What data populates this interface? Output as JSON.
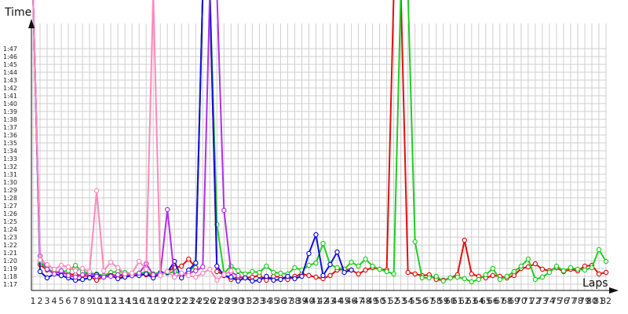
{
  "chart_data": {
    "type": "line",
    "xlabel": "Laps",
    "ylabel": "Time",
    "ylim": [
      "1:17",
      "1:48"
    ],
    "y_ticks": [
      "1:17",
      "1:18",
      "1:19",
      "1:20",
      "1:21",
      "1:22",
      "1:23",
      "1:24",
      "1:25",
      "1:26",
      "1:27",
      "1:28",
      "1:29",
      "1:30",
      "1:31",
      "1:32",
      "1:33",
      "1:34",
      "1:35",
      "1:36",
      "1:37",
      "1:38",
      "1:39",
      "1:40",
      "1:41",
      "1:42",
      "1:43",
      "1:44",
      "1:45",
      "1:46",
      "1:47"
    ],
    "x_ticks": [
      1,
      2,
      3,
      4,
      5,
      6,
      7,
      8,
      9,
      10,
      11,
      12,
      13,
      14,
      15,
      16,
      17,
      18,
      19,
      20,
      21,
      22,
      23,
      24,
      25,
      26,
      27,
      28,
      29,
      30,
      31,
      32,
      33,
      34,
      35,
      36,
      37,
      38,
      39,
      40,
      41,
      42,
      43,
      44,
      45,
      46,
      47,
      48,
      49,
      50,
      51,
      52,
      53,
      54,
      55,
      56,
      57,
      58,
      59,
      60,
      61,
      62,
      63,
      64,
      65,
      66,
      67,
      68,
      69,
      70,
      71,
      72,
      73,
      74,
      75,
      76,
      77,
      78,
      79,
      80,
      81,
      82
    ],
    "grid": true,
    "series": [
      {
        "color": "#e01010",
        "marker_laps": [],
        "points": [
          [
            1,
            120
          ],
          [
            2,
            79.5
          ],
          [
            3,
            78.8
          ],
          [
            4,
            78.6
          ],
          [
            5,
            78.4
          ],
          [
            6,
            78.3
          ],
          [
            7,
            78.2
          ],
          [
            8,
            78.1
          ],
          [
            9,
            78
          ],
          [
            10,
            77.5
          ],
          [
            11,
            78
          ],
          [
            12,
            78.2
          ],
          [
            13,
            78.1
          ],
          [
            14,
            78
          ],
          [
            15,
            78.1
          ],
          [
            16,
            78.3
          ],
          [
            17,
            78.2
          ],
          [
            18,
            78.3
          ],
          [
            19,
            78.1
          ],
          [
            20,
            78.6
          ],
          [
            21,
            79.1
          ],
          [
            22,
            79.3
          ],
          [
            23,
            80.2
          ],
          [
            24,
            79.1
          ],
          [
            25,
            120
          ],
          [
            26,
            120
          ],
          [
            27,
            78.6
          ],
          [
            28,
            78.2
          ],
          [
            29,
            77.6
          ],
          [
            30,
            77.9
          ],
          [
            31,
            77.8
          ],
          [
            32,
            77.9
          ],
          [
            33,
            78.1
          ],
          [
            34,
            77.5
          ],
          [
            35,
            78
          ],
          [
            36,
            77.9
          ],
          [
            37,
            77.6
          ],
          [
            38,
            78
          ],
          [
            39,
            78.3
          ],
          [
            40,
            78.1
          ],
          [
            41,
            77.9
          ],
          [
            42,
            77.7
          ],
          [
            43,
            78.1
          ],
          [
            44,
            78.8
          ],
          [
            45,
            78.9
          ],
          [
            46,
            78.8
          ],
          [
            47,
            78.3
          ],
          [
            48,
            78.8
          ],
          [
            49,
            79.1
          ],
          [
            50,
            78.9
          ],
          [
            51,
            78.8
          ],
          [
            52,
            120
          ],
          [
            53,
            120
          ],
          [
            54,
            78.5
          ],
          [
            55,
            78.3
          ],
          [
            56,
            78.1
          ],
          [
            57,
            78.2
          ],
          [
            58,
            77.6
          ],
          [
            59,
            77.5
          ],
          [
            60,
            77.8
          ],
          [
            61,
            78.2
          ],
          [
            62,
            82.6
          ],
          [
            63,
            78.3
          ],
          [
            64,
            78
          ],
          [
            65,
            77.8
          ],
          [
            66,
            78.1
          ],
          [
            67,
            78
          ],
          [
            68,
            77.8
          ],
          [
            69,
            78.1
          ],
          [
            70,
            79
          ],
          [
            71,
            79.2
          ],
          [
            72,
            79.6
          ],
          [
            73,
            78.9
          ],
          [
            74,
            78.7
          ],
          [
            75,
            79.1
          ],
          [
            76,
            78.6
          ],
          [
            77,
            78.9
          ],
          [
            78,
            78.7
          ],
          [
            79,
            79.3
          ],
          [
            80,
            79.4
          ],
          [
            81,
            78.3
          ],
          [
            82,
            78.5
          ]
        ]
      },
      {
        "color": "#22cc22",
        "marker_laps": [],
        "points": [
          [
            1,
            120
          ],
          [
            2,
            79.8
          ],
          [
            3,
            79
          ],
          [
            4,
            78.5
          ],
          [
            5,
            78.6
          ],
          [
            6,
            78.7
          ],
          [
            7,
            79.4
          ],
          [
            8,
            78.6
          ],
          [
            9,
            78.4
          ],
          [
            10,
            78.3
          ],
          [
            11,
            78.1
          ],
          [
            12,
            78.5
          ],
          [
            13,
            78.6
          ],
          [
            14,
            78.5
          ],
          [
            15,
            78.3
          ],
          [
            16,
            78.4
          ],
          [
            17,
            78.5
          ],
          [
            18,
            78.3
          ],
          [
            19,
            78.5
          ],
          [
            20,
            78.4
          ],
          [
            21,
            78.6
          ],
          [
            22,
            78.3
          ],
          [
            23,
            78.4
          ],
          [
            24,
            79.6
          ],
          [
            25,
            120
          ],
          [
            26,
            120
          ],
          [
            27,
            84.6
          ],
          [
            28,
            78.4
          ],
          [
            29,
            79.3
          ],
          [
            30,
            78.7
          ],
          [
            31,
            78.3
          ],
          [
            32,
            78.6
          ],
          [
            33,
            78.5
          ],
          [
            34,
            79.3
          ],
          [
            35,
            78.5
          ],
          [
            36,
            78.4
          ],
          [
            37,
            78.3
          ],
          [
            38,
            79.1
          ],
          [
            39,
            78.8
          ],
          [
            40,
            79.4
          ],
          [
            41,
            79.7
          ],
          [
            42,
            82.2
          ],
          [
            43,
            79.5
          ],
          [
            44,
            79.1
          ],
          [
            45,
            78.9
          ],
          [
            46,
            79.8
          ],
          [
            47,
            79.3
          ],
          [
            48,
            80.2
          ],
          [
            49,
            79.3
          ],
          [
            50,
            78.9
          ],
          [
            51,
            78.6
          ],
          [
            52,
            78.3
          ],
          [
            53,
            120
          ],
          [
            54,
            120
          ],
          [
            55,
            82.4
          ],
          [
            56,
            77.8
          ],
          [
            57,
            77.8
          ],
          [
            58,
            78
          ],
          [
            59,
            77.4
          ],
          [
            60,
            77.8
          ],
          [
            61,
            77.9
          ],
          [
            62,
            77.7
          ],
          [
            63,
            77.3
          ],
          [
            64,
            77.6
          ],
          [
            65,
            78.2
          ],
          [
            66,
            79
          ],
          [
            67,
            77.6
          ],
          [
            68,
            78
          ],
          [
            69,
            78.6
          ],
          [
            70,
            79.3
          ],
          [
            71,
            80.2
          ],
          [
            72,
            77.6
          ],
          [
            73,
            77.9
          ],
          [
            74,
            78.5
          ],
          [
            75,
            79.3
          ],
          [
            76,
            78.7
          ],
          [
            77,
            79.1
          ],
          [
            78,
            78.9
          ],
          [
            79,
            78.8
          ],
          [
            80,
            79.1
          ],
          [
            81,
            81.4
          ],
          [
            82,
            79.9
          ]
        ]
      },
      {
        "color": "#1010e0",
        "marker_laps": [],
        "points": [
          [
            1,
            119.7
          ],
          [
            2,
            78.6
          ],
          [
            3,
            77.8
          ],
          [
            4,
            78.3
          ],
          [
            5,
            78.1
          ],
          [
            6,
            77.8
          ],
          [
            7,
            77.5
          ],
          [
            8,
            77.6
          ],
          [
            9,
            77.8
          ],
          [
            10,
            78.2
          ],
          [
            11,
            77.9
          ],
          [
            12,
            78.1
          ],
          [
            13,
            77.7
          ],
          [
            14,
            77.9
          ],
          [
            15,
            78.1
          ],
          [
            16,
            78.1
          ],
          [
            17,
            78.3
          ],
          [
            18,
            77.8
          ],
          [
            19,
            78.4
          ],
          [
            20,
            78.5
          ],
          [
            21,
            79.9
          ],
          [
            22,
            77.8
          ],
          [
            23,
            78.8
          ],
          [
            24,
            79.7
          ],
          [
            25,
            120
          ],
          [
            26,
            120
          ],
          [
            27,
            79.3
          ],
          [
            28,
            78.1
          ],
          [
            29,
            77.9
          ],
          [
            30,
            77.4
          ],
          [
            31,
            77.8
          ],
          [
            32,
            77.4
          ],
          [
            33,
            77.5
          ],
          [
            34,
            78
          ],
          [
            35,
            77.5
          ],
          [
            36,
            77.6
          ],
          [
            37,
            78
          ],
          [
            38,
            77.7
          ],
          [
            39,
            78
          ],
          [
            40,
            80.9
          ],
          [
            41,
            83.3
          ],
          [
            42,
            78.1
          ],
          [
            43,
            79.5
          ],
          [
            44,
            81.1
          ],
          [
            45,
            78.5
          ],
          [
            46,
            78.8
          ]
        ]
      },
      {
        "color": "#b030e8",
        "marker_laps": [],
        "points": [
          [
            1,
            120
          ],
          [
            2,
            80.6
          ],
          [
            3,
            78.9
          ],
          [
            4,
            78.3
          ],
          [
            5,
            78.7
          ],
          [
            6,
            78.1
          ],
          [
            7,
            77.9
          ],
          [
            8,
            78.2
          ],
          [
            9,
            78.4
          ],
          [
            10,
            78
          ],
          [
            11,
            77.9
          ],
          [
            12,
            78
          ],
          [
            13,
            78.2
          ],
          [
            14,
            78.3
          ],
          [
            15,
            78.1
          ],
          [
            16,
            78.4
          ],
          [
            17,
            79.6
          ],
          [
            18,
            78.2
          ],
          [
            19,
            78.3
          ],
          [
            20,
            86.5
          ],
          [
            21,
            77.9
          ],
          [
            22,
            78.3
          ],
          [
            23,
            78.4
          ],
          [
            24,
            78.7
          ],
          [
            25,
            79.2
          ],
          [
            26,
            120
          ],
          [
            27,
            120
          ],
          [
            28,
            86.4
          ],
          [
            29,
            78.5
          ],
          [
            30,
            78.1
          ]
        ]
      },
      {
        "color": "#ff88bb",
        "marker_laps": [],
        "points": [
          [
            1,
            120
          ],
          [
            2,
            80.1
          ],
          [
            3,
            79.5
          ],
          [
            4,
            78.9
          ],
          [
            5,
            79.4
          ],
          [
            6,
            79.2
          ],
          [
            7,
            78.7
          ],
          [
            8,
            79
          ],
          [
            9,
            78.6
          ],
          [
            10,
            88.9
          ],
          [
            11,
            78.7
          ],
          [
            12,
            79.8
          ],
          [
            13,
            79.1
          ],
          [
            14,
            78.3
          ],
          [
            15,
            78.4
          ],
          [
            16,
            79.9
          ],
          [
            17,
            78.9
          ],
          [
            18,
            120
          ],
          [
            19,
            78.1
          ],
          [
            20,
            78.6
          ],
          [
            21,
            77.9
          ],
          [
            22,
            78.4
          ],
          [
            23,
            78.1
          ],
          [
            24,
            77.9
          ],
          [
            25,
            78.4
          ],
          [
            26,
            78.9
          ],
          [
            27,
            77.5
          ],
          [
            28,
            78.2
          ],
          [
            29,
            78.7
          ]
        ]
      }
    ]
  }
}
